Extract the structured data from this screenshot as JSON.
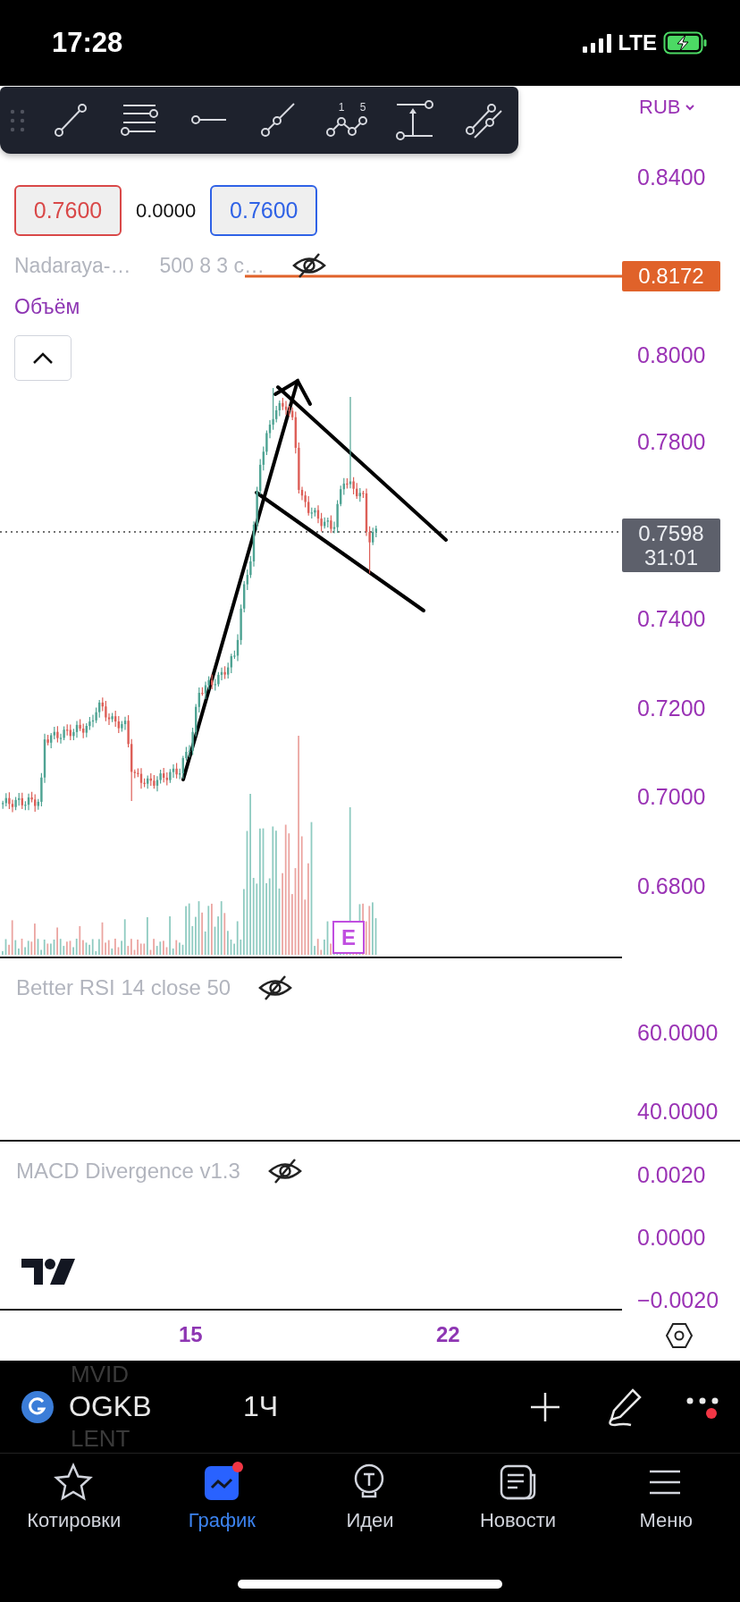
{
  "status_bar": {
    "time": "17:28",
    "network": "LTE"
  },
  "toolbar": {
    "tools": [
      {
        "kind": "line"
      },
      {
        "kind": "fib"
      },
      {
        "kind": "hline"
      },
      {
        "kind": "ray"
      },
      {
        "kind": "wave",
        "marks": [
          "1",
          "5"
        ]
      },
      {
        "kind": "range"
      },
      {
        "kind": "channel"
      }
    ]
  },
  "main_pane": {
    "prices": [
      {
        "kind": "bid",
        "text": "0.7600"
      },
      {
        "kind": "spread",
        "text": "0.0000"
      },
      {
        "kind": "ask",
        "text": "0.7600"
      }
    ],
    "indicators": [
      {
        "name": "Nadaraya-…",
        "params": "500 8 3 c…",
        "hidden": true
      }
    ],
    "volume_label": "Объём",
    "currency": "RUB",
    "price_axis": [
      "0.8400",
      "0.8000",
      "0.7800",
      "0.7400",
      "0.7200",
      "0.7000",
      "0.6800"
    ],
    "price_tags": [
      {
        "kind": "line",
        "value": "0.8172",
        "color": "#e0622a"
      },
      {
        "kind": "last",
        "value": "0.7598",
        "countdown": "31:01"
      }
    ],
    "earnings_mark": "E"
  },
  "panes": [
    {
      "title": "Better RSI 14 close 50",
      "hidden": true,
      "axis": [
        "60.0000",
        "40.0000"
      ]
    },
    {
      "title": "MACD Divergence v1.3",
      "hidden": true,
      "axis": [
        "0.0020",
        "0.0000",
        "−0.0020"
      ]
    }
  ],
  "time_axis": [
    "15",
    "22"
  ],
  "symbol_bar": {
    "above": "MVID",
    "symbol": "OGKB",
    "interval": "1Ч",
    "below": "LENT",
    "notification": true
  },
  "tabs": [
    {
      "kind": "star",
      "label": "Котировки",
      "selected": false,
      "badge": false
    },
    {
      "kind": "chart",
      "label": "График",
      "selected": true,
      "badge": true
    },
    {
      "kind": "bulb",
      "label": "Идеи",
      "selected": false,
      "badge": false
    },
    {
      "kind": "news",
      "label": "Новости",
      "selected": false,
      "badge": false
    },
    {
      "kind": "menu",
      "label": "Меню",
      "selected": false,
      "badge": false
    }
  ]
}
